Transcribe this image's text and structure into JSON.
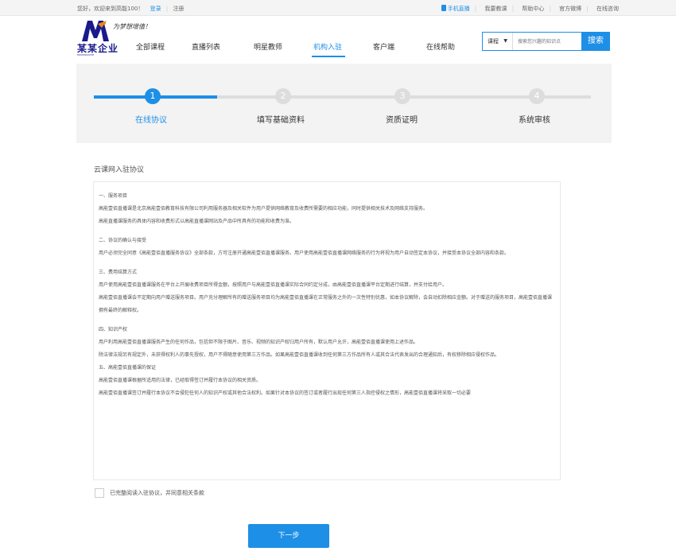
{
  "topbar": {
    "welcome": "您好，欢迎来到高能100！",
    "login": "登录",
    "register": "注册",
    "links": [
      "手机直播",
      "我要教课",
      "帮助中心",
      "官方微博",
      "在线咨询"
    ]
  },
  "logo": {
    "slogan": "为梦想增值！",
    "name": "某某企业",
    "sub": "MOUMOUQIYE"
  },
  "nav": {
    "items": [
      {
        "label": "全部课程"
      },
      {
        "label": "直播列表"
      },
      {
        "label": "明星教师"
      },
      {
        "label": "机构入驻"
      },
      {
        "label": "客户端"
      },
      {
        "label": "在线帮助"
      }
    ],
    "active_index": 3
  },
  "search": {
    "select_value": "课程",
    "placeholder": "搜索您兴趣的知识点",
    "button": "搜索"
  },
  "steps": [
    {
      "number": "1",
      "label": "在线协议"
    },
    {
      "number": "2",
      "label": "填写基础资料"
    },
    {
      "number": "3",
      "label": "资质证明"
    },
    {
      "number": "4",
      "label": "系统审核"
    }
  ],
  "agreement": {
    "title": "云课网入驻协议",
    "sections": [
      {
        "heading": "一、服务项目",
        "paragraphs": [
          "高能壹佰直播课是北京高能壹佰教育科技有限公司利用服务器及相关软件为用户提供网络教育及收费所需要的相应功能，同时提供相关技术及网络支持服务。",
          "高能直播课服务的具体内容和收费形式以高能直播课网站及产品中所具有的功能和收费为准。"
        ]
      },
      {
        "heading": "二、协议的确认与接受",
        "paragraphs": [
          "用户必须完全同意《高能壹佰直播服务协议》全部条款，方可注册开通高能壹佰直播课服务。用户使用高能壹佰直播课网络服务的行为将视为用户自动签定本协议，并接受本协议全部内容和条款。"
        ]
      },
      {
        "heading": "三、费用结算方式",
        "paragraphs": [
          "用户使用高能壹佰直播课服务在平台上开展收费项目所得金额，按照用户与高能壹佰直播课实际合同约定分成，由高能壹佰直播课平台定期进行结算，并支付给用户。",
          "高能壹佰直播课会不定期向用户赠送服务项目。用户充分理解所有的赠送服务项目均为高能壹佰直播课在正常服务之外的一次性特别优惠，如本协议解除，会自动扣除相应金额。对于赠送的服务项目，高能壹佰直播课拥有最终的解释权。"
        ]
      },
      {
        "heading": "四、知识产权",
        "paragraphs": [
          "用户利用高能壹佰直播课服务产生的任何作品，包括但不限于图片、音乐、视频的知识产权归用户所有，默认用户允许，高能壹佰直播课使用上述作品。",
          "除法律法规另有规定外，未获得权利人的事先授权，用户不得随意使用第三方作品。如果高能壹佰直播课收到任何第三方作品所有人或其合法代表发出的合理通知后，有权移除相应侵权作品。"
        ]
      },
      {
        "heading": "五、高能壹佰直播课的保证",
        "paragraphs": [
          "高能壹佰直播课根据所适用的法律，已经取得签订并履行本协议的相关资质。",
          "高能壹佰直播课签订并履行本协议不会侵犯任何人的知识产权或其他合法权利。如果针对本协议的签订或者履行出现任何第三人指控侵权之情形，高能壹佰直播课将采取一切必要"
        ]
      }
    ]
  },
  "checkbox_label": "已完整阅读入驻协议，并同意相关条款",
  "next_button": "下一步",
  "colors": {
    "accent": "#1e8fe6",
    "logo": "#1a1a8a"
  }
}
